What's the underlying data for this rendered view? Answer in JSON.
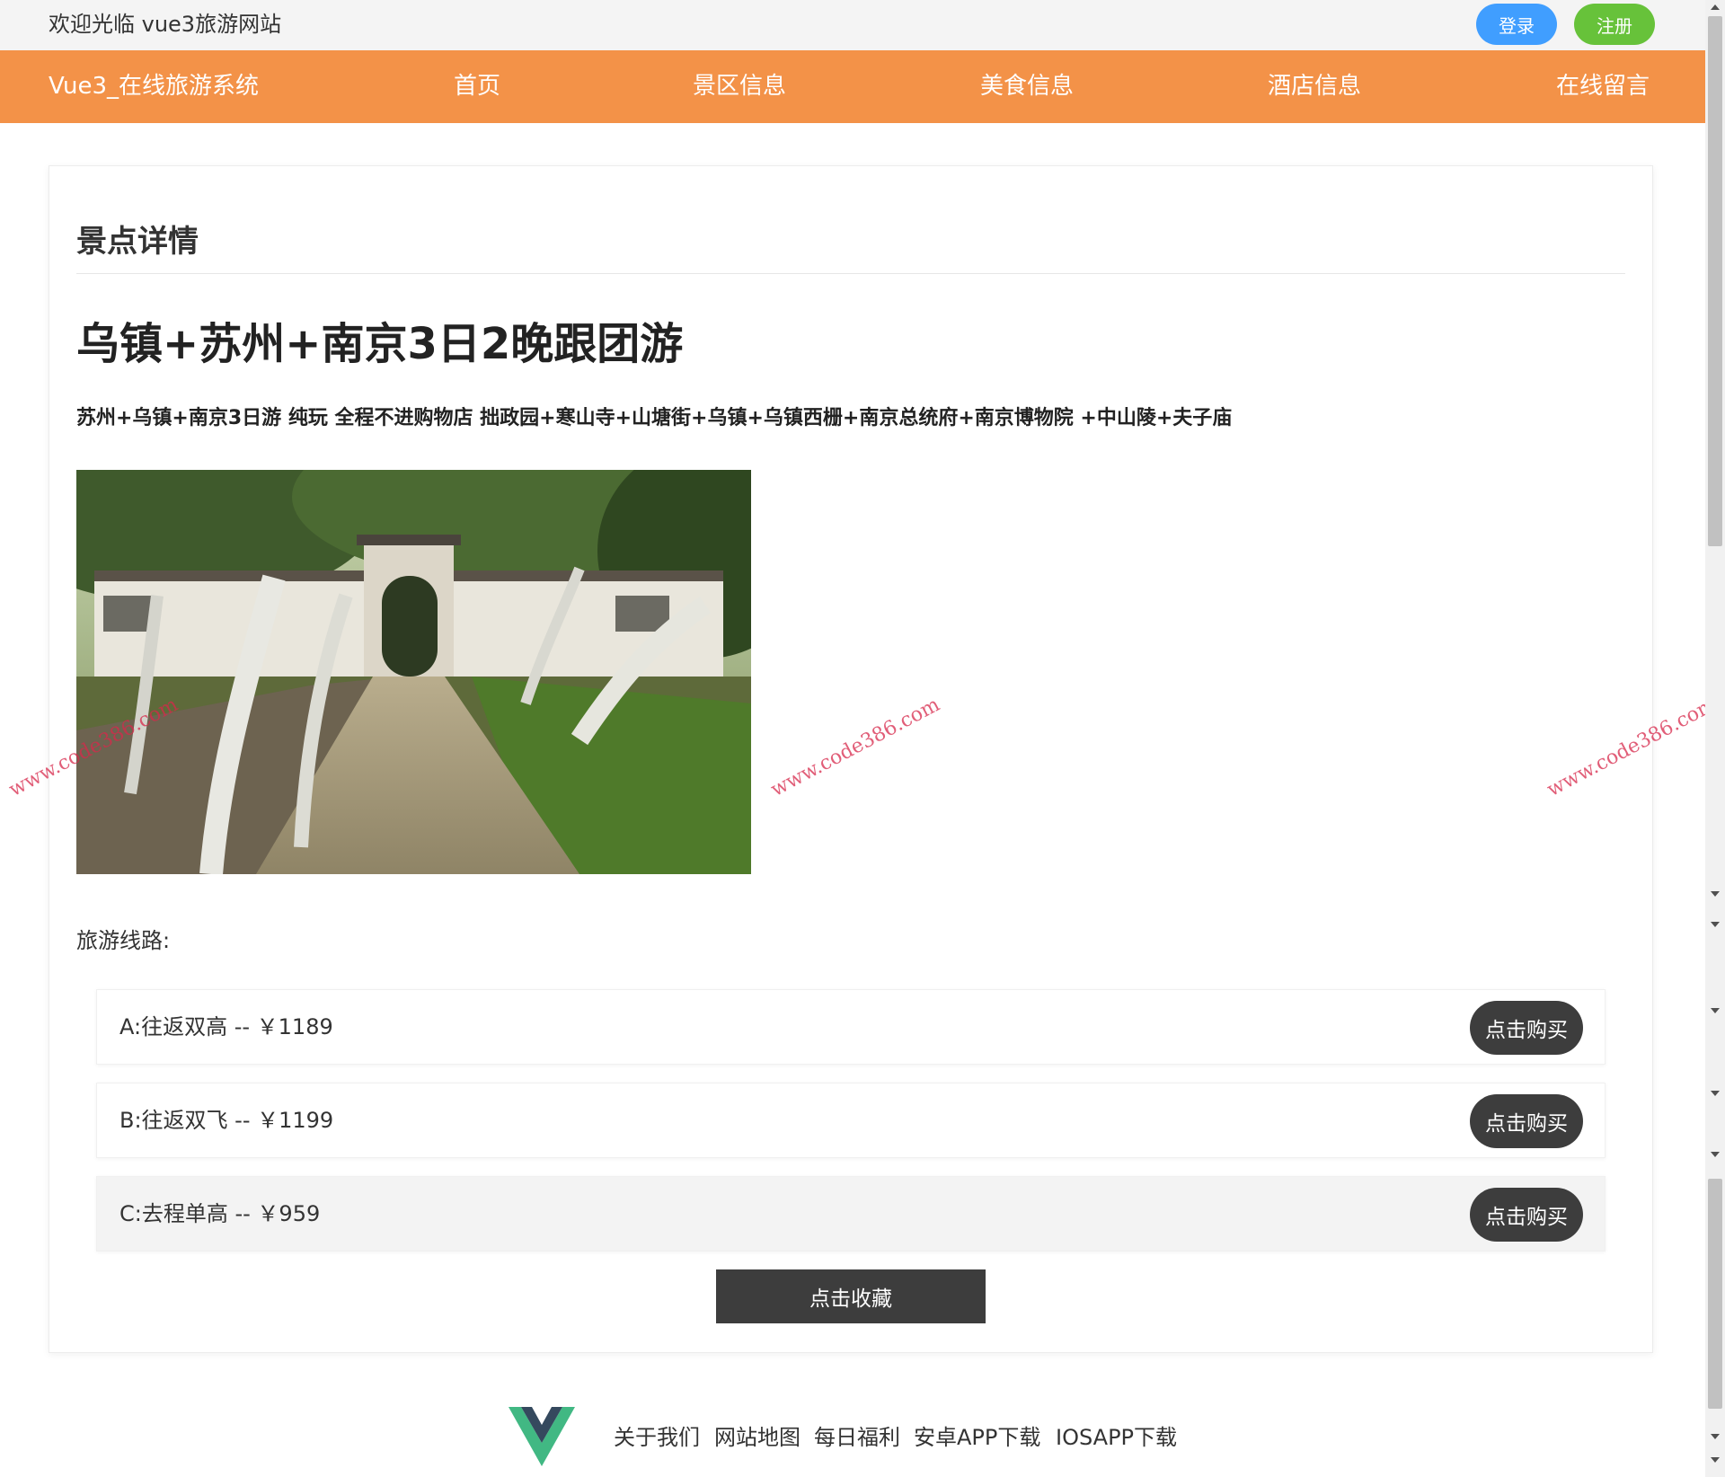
{
  "header": {
    "welcome": "欢迎光临 vue3旅游网站",
    "login_label": "登录",
    "register_label": "注册"
  },
  "nav": {
    "brand": "Vue3_在线旅游系统",
    "items": [
      "首页",
      "景区信息",
      "美食信息",
      "酒店信息",
      "在线留言"
    ]
  },
  "detail": {
    "section_title": "景点详情",
    "title": "乌镇+苏州+南京3日2晚跟团游",
    "description": "苏州+乌镇+南京3日游 纯玩 全程不进购物店 拙政园+寒山寺+山塘街+乌镇+乌镇西栅+南京总统府+南京博物院 +中山陵+夫子庙",
    "routes_label": "旅游线路:",
    "routes": [
      {
        "text": "A:往返双高 -- ￥1189",
        "button": "点击购买"
      },
      {
        "text": "B:往返双飞 -- ￥1199",
        "button": "点击购买"
      },
      {
        "text": "C:去程单高 -- ￥959",
        "button": "点击购买"
      }
    ],
    "favorite_label": "点击收藏"
  },
  "watermark": "www.code386.com",
  "footer": {
    "logo_icon": "vue-logo-icon",
    "links": [
      "关于我们",
      "网站地图",
      "每日福利",
      "安卓APP下载",
      "IOSAPP下载"
    ]
  },
  "colors": {
    "nav_bg": "#f39248",
    "login": "#409eff",
    "register": "#67c23a",
    "dark_button": "#3d3d3d"
  }
}
